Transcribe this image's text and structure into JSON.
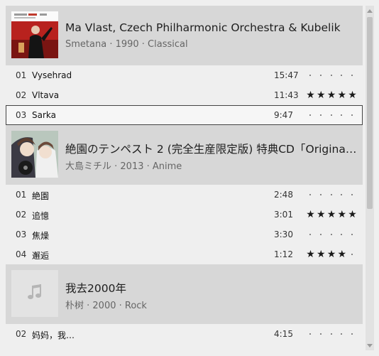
{
  "albums": [
    {
      "title": "Ma Vlast, Czech Philharmonic Orchestra & Kubelik",
      "meta": "Smetana · 1990 · Classical",
      "cover": "cover-art-photo",
      "tracks": [
        {
          "num": "01",
          "name": "Vysehrad",
          "duration": "15:47",
          "rating": 0
        },
        {
          "num": "02",
          "name": "Vltava",
          "duration": "11:43",
          "rating": 5
        },
        {
          "num": "03",
          "name": "Sarka",
          "duration": "9:47",
          "rating": 0,
          "selected": true
        }
      ]
    },
    {
      "title": "絶園のテンペスト 2 (完全生産限定版) 特典CD「Original …",
      "meta": "大島ミチル · 2013 · Anime",
      "cover": "cover-art-anime",
      "tracks": [
        {
          "num": "01",
          "name": "絶園",
          "duration": "2:48",
          "rating": 0
        },
        {
          "num": "02",
          "name": "追憶",
          "duration": "3:01",
          "rating": 5
        },
        {
          "num": "03",
          "name": "焦燥",
          "duration": "3:30",
          "rating": 0
        },
        {
          "num": "04",
          "name": "邂逅",
          "duration": "1:12",
          "rating": 4
        }
      ]
    },
    {
      "title": "我去2000年",
      "meta": "朴树 · 2000 · Rock",
      "cover": "music-note-icon",
      "tracks": [
        {
          "num": "02",
          "name": "妈妈，我…",
          "duration": "4:15",
          "rating": 0
        }
      ]
    }
  ],
  "rating_max": 5,
  "colors": {
    "header_bg": "#d7d7d7",
    "background": "#efefef",
    "scroll_thumb": "#c2c2c2"
  }
}
